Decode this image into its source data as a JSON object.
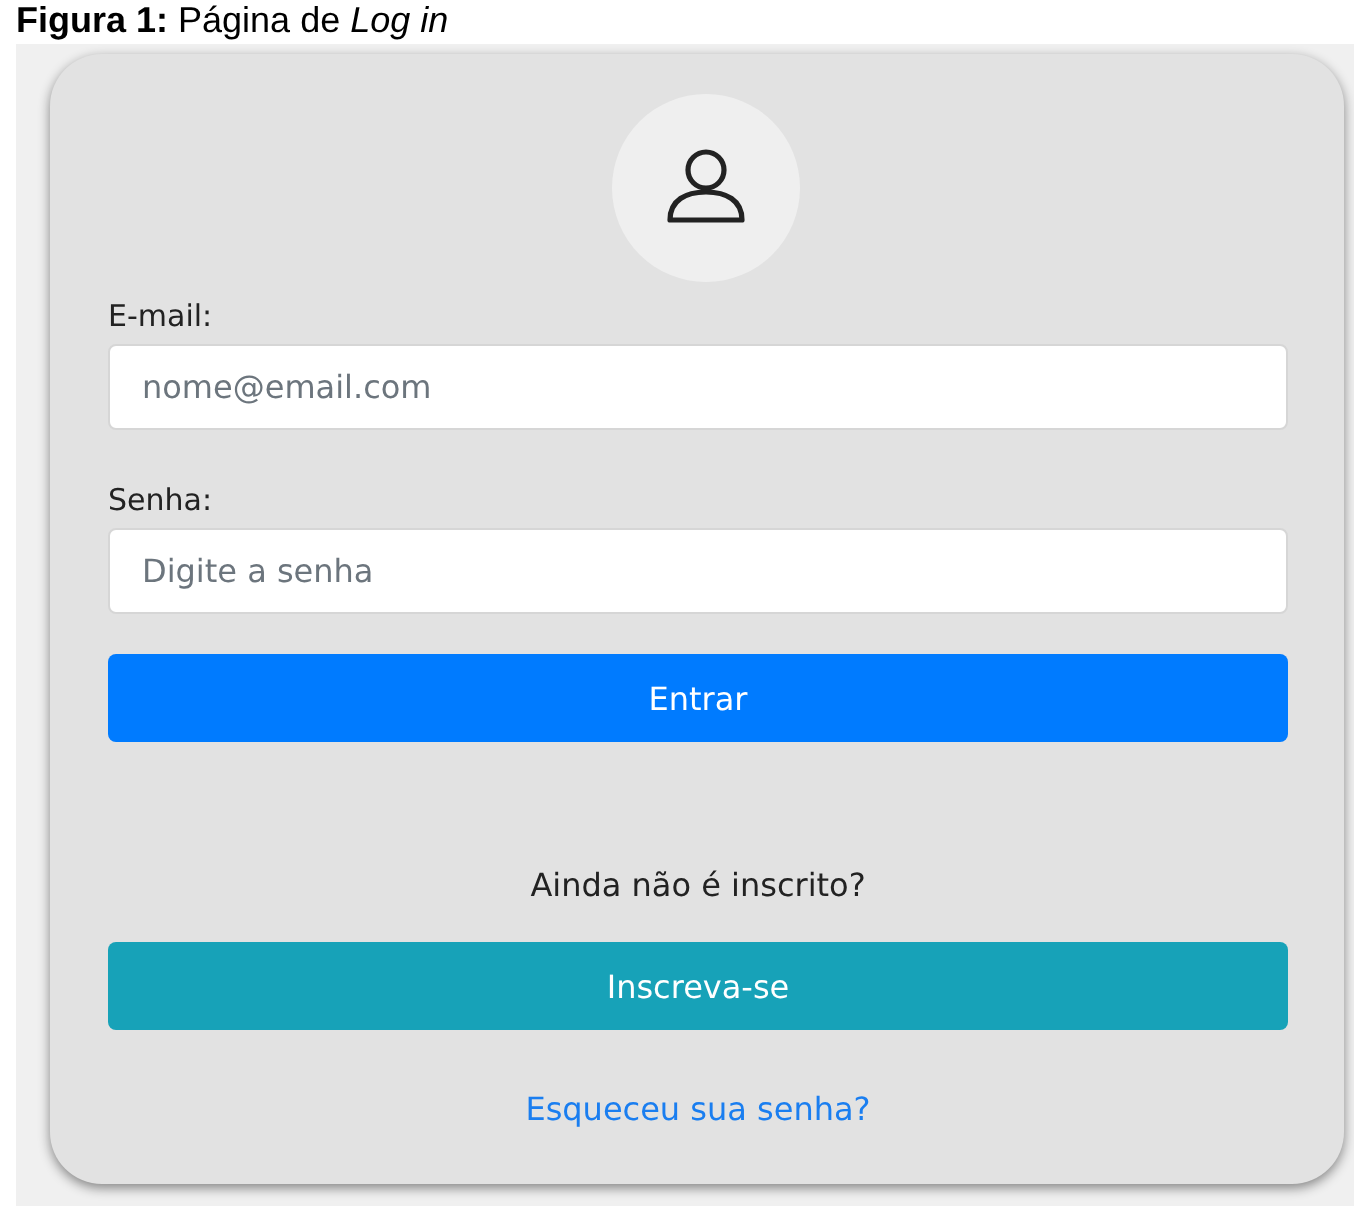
{
  "caption": "**Figura 1:** Página de *Log in*",
  "fields": [
    {
      "label": "E-mail:",
      "placeholder": "nome@email.com"
    },
    {
      "label": "Senha:",
      "placeholder": "Digite a senha"
    }
  ],
  "login_button": "Entrar",
  "signup_prompt": "Ainda não é inscrito?",
  "signup_button": "Inscreva-se",
  "forgot_link": "Esqueceu sua senha?"
}
